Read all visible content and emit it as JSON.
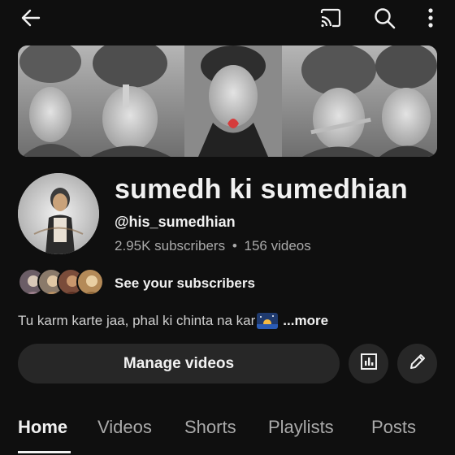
{
  "topbar": {
    "icons": [
      "arrow-left-icon",
      "cast-icon",
      "search-icon",
      "more-vertical-icon"
    ]
  },
  "channel": {
    "name": "sumedh ki sumedhian",
    "handle": "@his_sumedhian",
    "subscribers": "2.95K subscribers",
    "separator": "•",
    "videos": "156 videos"
  },
  "subscribers_row": {
    "label": "See your subscribers"
  },
  "description": {
    "text": "Tu karm karte jaa, phal ki chinta na kar",
    "more": "...more"
  },
  "actions": {
    "manage_label": "Manage videos",
    "analytics_icon": "analytics-icon",
    "edit_icon": "pencil-icon"
  },
  "tabs": [
    {
      "label": "Home",
      "active": true
    },
    {
      "label": "Videos",
      "active": false
    },
    {
      "label": "Shorts",
      "active": false
    },
    {
      "label": "Playlists",
      "active": false
    },
    {
      "label": "Posts",
      "active": false
    }
  ],
  "colors": {
    "background": "#0f0f0f",
    "button_bg": "#272727",
    "text_primary": "#f1f1f1",
    "text_secondary": "#aaaaaa"
  }
}
